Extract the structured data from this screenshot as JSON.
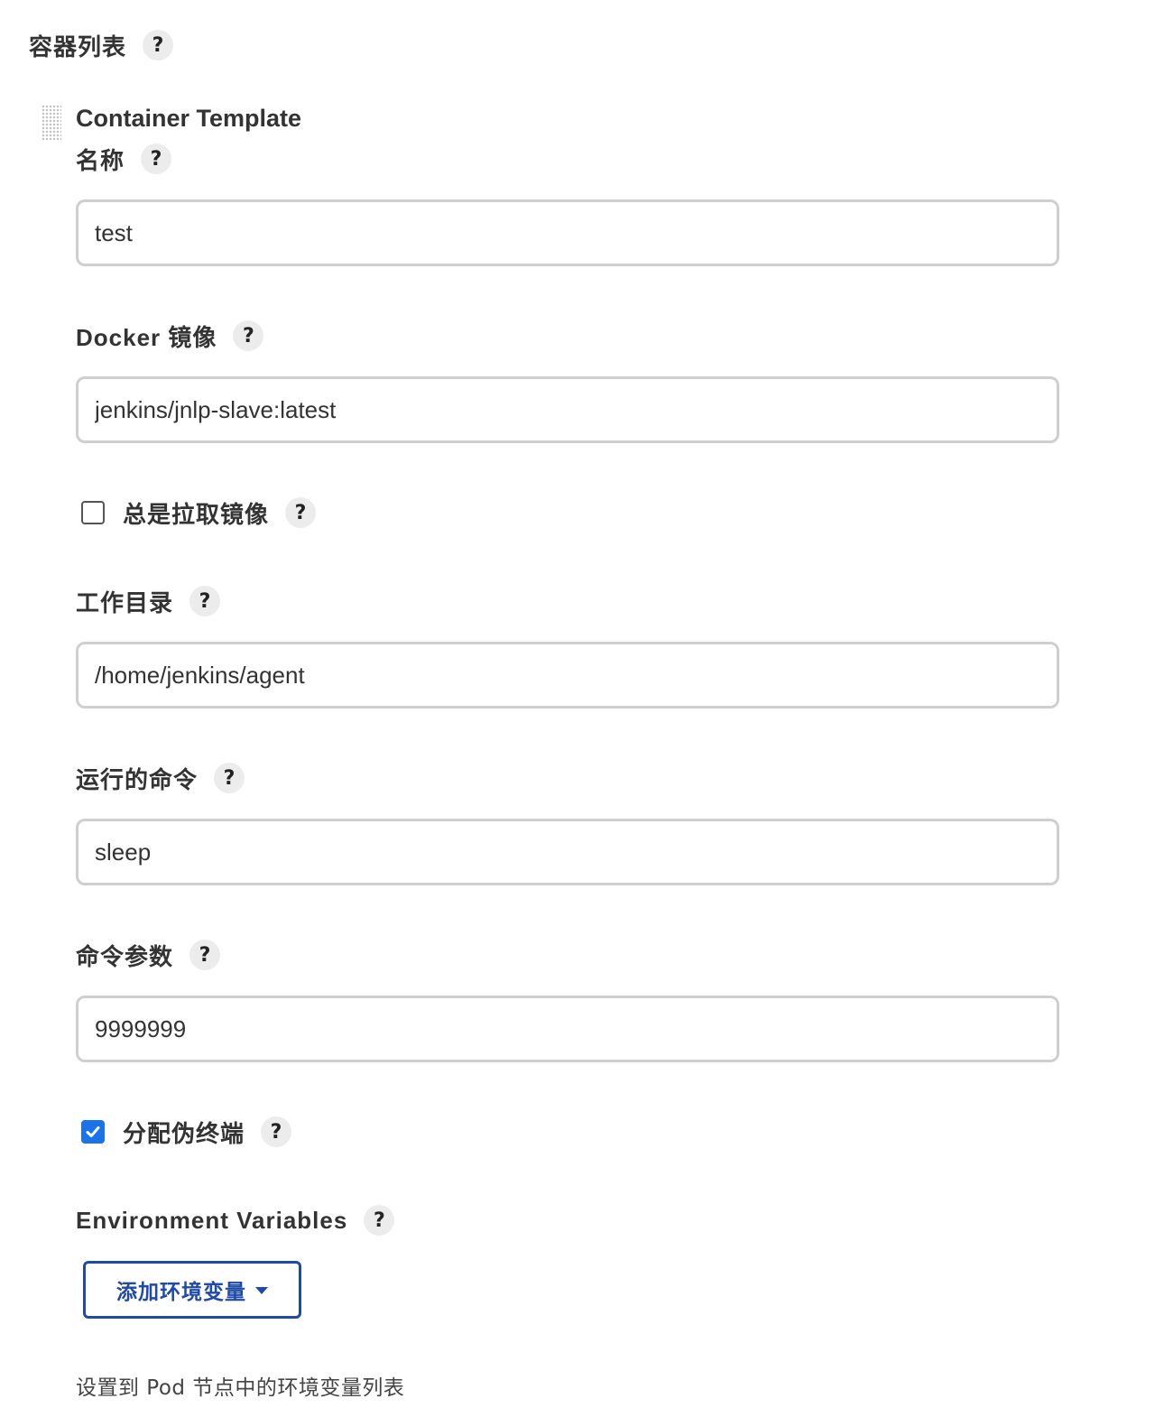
{
  "section": {
    "title": "容器列表",
    "help": "?"
  },
  "template": {
    "title": "Container Template"
  },
  "fields": {
    "name": {
      "label": "名称",
      "value": "test",
      "help": "?"
    },
    "docker_image": {
      "label": "Docker 镜像",
      "value": "jenkins/jnlp-slave:latest",
      "help": "?"
    },
    "always_pull": {
      "label": "总是拉取镜像",
      "checked": false,
      "help": "?"
    },
    "working_dir": {
      "label": "工作目录",
      "value": "/home/jenkins/agent",
      "help": "?"
    },
    "command": {
      "label": "运行的命令",
      "value": "sleep",
      "help": "?"
    },
    "args": {
      "label": "命令参数",
      "value": "9999999",
      "help": "?"
    },
    "tty": {
      "label": "分配伪终端",
      "checked": true,
      "help": "?"
    }
  },
  "env": {
    "label": "Environment Variables",
    "help": "?",
    "add_button": "添加环境变量",
    "description": "设置到 Pod 节点中的环境变量列表"
  },
  "colors": {
    "accent": "#1a73e8",
    "button_border": "#1f4aa8",
    "input_border": "#cfcfcf",
    "help_bg": "#ececec"
  }
}
